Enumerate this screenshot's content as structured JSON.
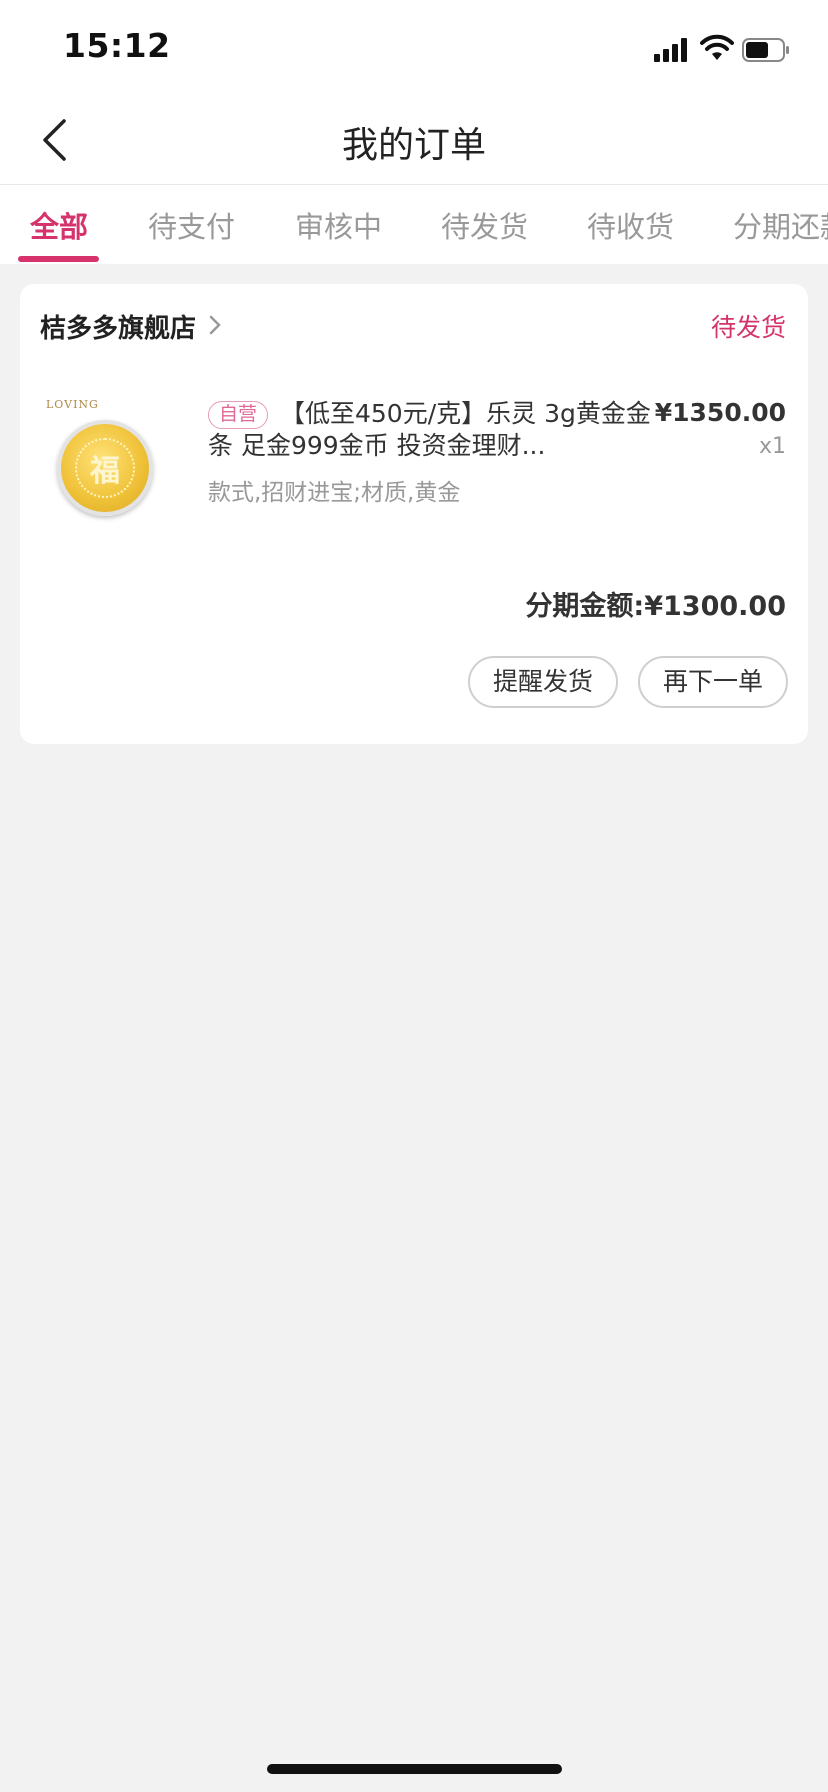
{
  "status_bar": {
    "time": "15:12"
  },
  "nav": {
    "title": "我的订单"
  },
  "tabs": [
    {
      "label": "全部",
      "active": true
    },
    {
      "label": "待支付",
      "active": false
    },
    {
      "label": "审核中",
      "active": false
    },
    {
      "label": "待发货",
      "active": false
    },
    {
      "label": "待收货",
      "active": false
    },
    {
      "label": "分期还款",
      "active": false
    }
  ],
  "order": {
    "store_name": "桔多多旗舰店",
    "status": "待发货",
    "product": {
      "thumb_brand": "LOVING",
      "coin_glyph": "福",
      "tag": "自营",
      "title": "【低至450元/克】乐灵 3g黄金金条 足金999金币 投资金理财...",
      "spec": "款式,招财进宝;材质,黄金",
      "price": "¥1350.00",
      "quantity": "x1"
    },
    "installment_amount": "分期金额:¥1300.00",
    "buttons": {
      "remind": "提醒发货",
      "reorder": "再下一单"
    }
  },
  "colors": {
    "accent": "#d6336c",
    "background": "#f2f2f2"
  }
}
